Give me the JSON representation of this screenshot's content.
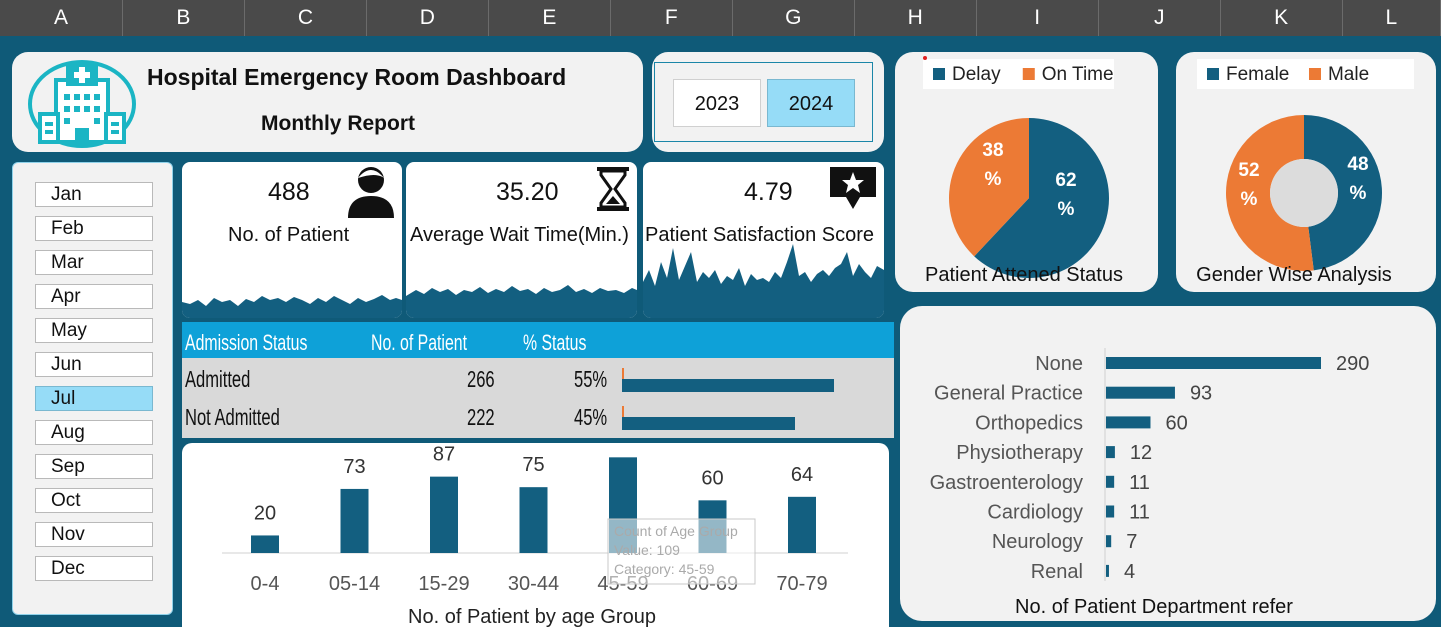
{
  "columns": [
    "A",
    "B",
    "C",
    "D",
    "E",
    "F",
    "G",
    "H",
    "I",
    "J",
    "K",
    "L"
  ],
  "header": {
    "title": "Hospital Emergency Room Dashboard",
    "subtitle": "Monthly Report"
  },
  "years": [
    {
      "label": "2023",
      "selected": false
    },
    {
      "label": "2024",
      "selected": true
    }
  ],
  "months": [
    {
      "label": "Jan",
      "selected": false
    },
    {
      "label": "Feb",
      "selected": false
    },
    {
      "label": "Mar",
      "selected": false
    },
    {
      "label": "Apr",
      "selected": false
    },
    {
      "label": "May",
      "selected": false
    },
    {
      "label": "Jun",
      "selected": false
    },
    {
      "label": "Jul",
      "selected": true
    },
    {
      "label": "Aug",
      "selected": false
    },
    {
      "label": "Sep",
      "selected": false
    },
    {
      "label": "Oct",
      "selected": false
    },
    {
      "label": "Nov",
      "selected": false
    },
    {
      "label": "Dec",
      "selected": false
    }
  ],
  "kpis": {
    "patients": {
      "value": "488",
      "label": "No. of Patient",
      "icon": "person-icon"
    },
    "wait": {
      "value": "35.20",
      "label": "Average Wait Time(Min.)",
      "icon": "hourglass-icon"
    },
    "satisfaction": {
      "value": "4.79",
      "label": "Patient Satisfaction Score",
      "icon": "star-speech-icon"
    }
  },
  "admission": {
    "headers": [
      "Admission Status",
      "No. of Patient",
      "% Status"
    ],
    "rows": [
      {
        "status": "Admitted",
        "count": "266",
        "pct": "55%",
        "fraction": 0.55
      },
      {
        "status": "Not Admitted",
        "count": "222",
        "pct": "45%",
        "fraction": 0.45
      }
    ]
  },
  "colors": {
    "navy": "#135f80",
    "orange": "#ec7a35",
    "accent_blue": "#0ea1d8",
    "background": "#0f5a78"
  },
  "chart_data": [
    {
      "type": "pie",
      "title": "Patient Attened Status",
      "legend": "top",
      "series": [
        {
          "name": "Delay",
          "value": 62,
          "label1": "62",
          "label2": "%",
          "color": "#135f80"
        },
        {
          "name": "On Time",
          "value": 38,
          "label1": "38",
          "label2": "%",
          "color": "#ec7a35"
        }
      ]
    },
    {
      "type": "pie",
      "subtype": "donut",
      "title": "Gender Wise Analysis",
      "legend": "top",
      "series": [
        {
          "name": "Female",
          "value": 48,
          "label1": "48",
          "label2": "%",
          "color": "#135f80"
        },
        {
          "name": "Male",
          "value": 52,
          "label1": "52",
          "label2": "%",
          "color": "#ec7a35"
        }
      ]
    },
    {
      "type": "bar",
      "title": "No. of Patient by age Group",
      "categories": [
        "0-4",
        "05-14",
        "15-29",
        "30-44",
        "45-59",
        "60-69",
        "70-79"
      ],
      "values": [
        20,
        73,
        87,
        75,
        109,
        60,
        64
      ],
      "ylim": [
        0,
        140
      ],
      "grid": false,
      "tooltip": {
        "line1": "Count of Age Group",
        "line2": "Value: 109",
        "line3": "Category: 45-59"
      }
    },
    {
      "type": "bar",
      "orientation": "horizontal",
      "title": "No. of Patient Department refer",
      "categories": [
        "None",
        "General Practice",
        "Orthopedics",
        "Physiotherapy",
        "Gastroenterology",
        "Cardiology",
        "Neurology",
        "Renal"
      ],
      "values": [
        290,
        93,
        60,
        12,
        11,
        11,
        7,
        4
      ],
      "xlim": [
        0,
        290
      ]
    }
  ]
}
